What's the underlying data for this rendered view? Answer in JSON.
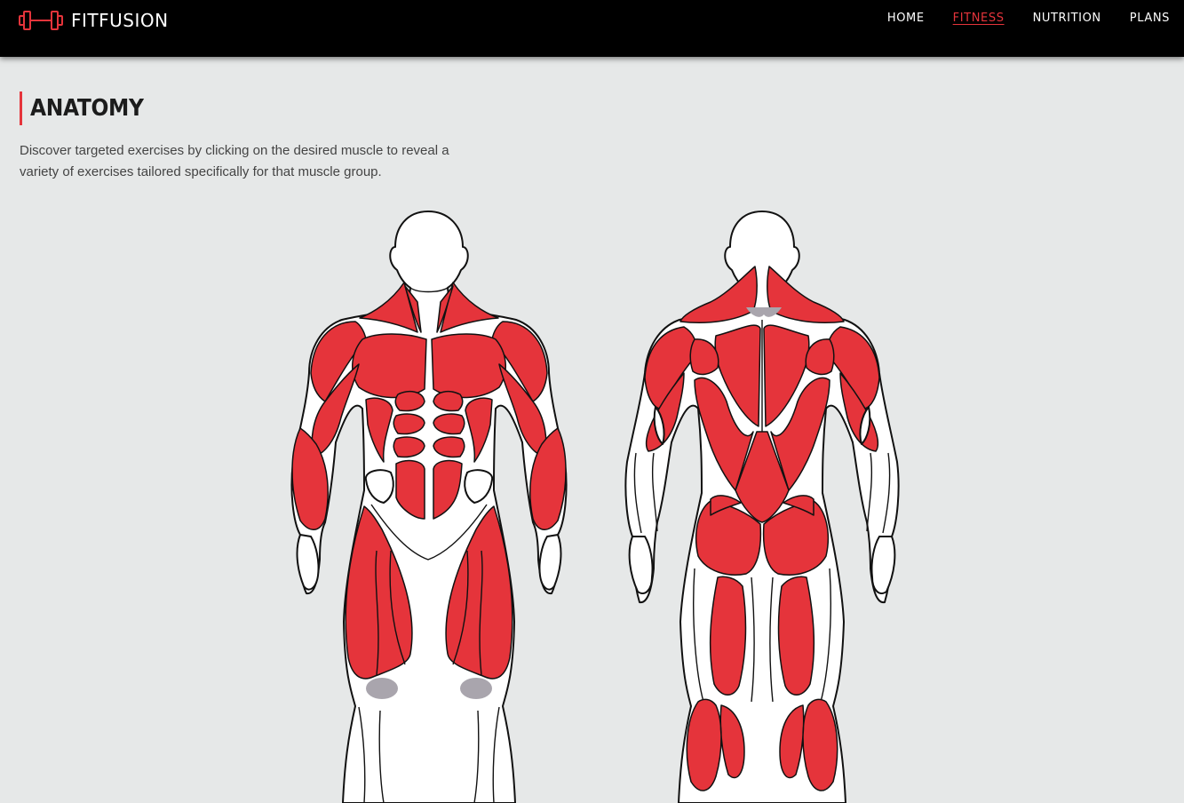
{
  "brand": {
    "name": "FITFUSION",
    "logo_icon": "dumbbell-icon",
    "accent": "#e5343b"
  },
  "nav": {
    "items": [
      {
        "label": "HOME",
        "active": false
      },
      {
        "label": "FITNESS",
        "active": true
      },
      {
        "label": "NUTRITION",
        "active": false
      },
      {
        "label": "PLANS",
        "active": false
      }
    ]
  },
  "page": {
    "title": "ANATOMY",
    "intro": "Discover targeted exercises by clicking on the desired muscle to reveal a variety of exercises tailored specifically for that muscle group."
  },
  "colors": {
    "muscle": "#e5343b",
    "background": "#e6e8e8",
    "header": "#000000"
  }
}
